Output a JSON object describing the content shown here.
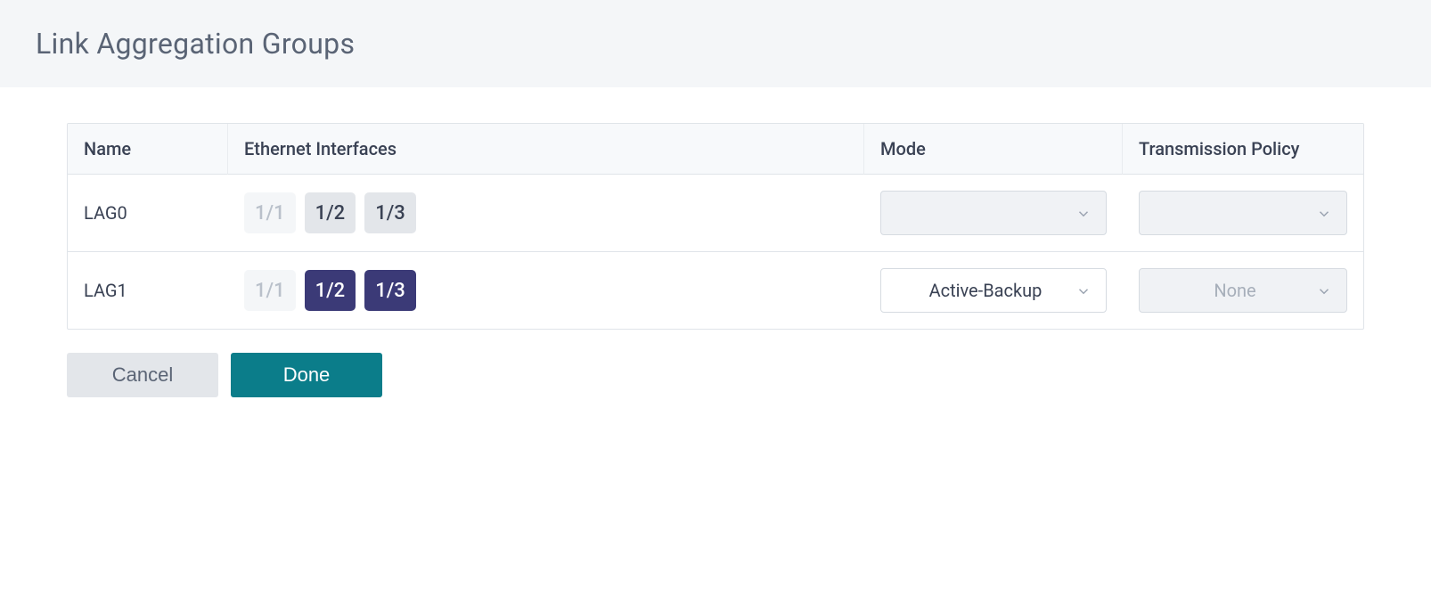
{
  "header": {
    "title": "Link Aggregation Groups"
  },
  "table": {
    "columns": {
      "name": "Name",
      "ethernet": "Ethernet Interfaces",
      "mode": "Mode",
      "policy": "Transmission Policy"
    },
    "rows": [
      {
        "name": "LAG0",
        "interfaces": [
          {
            "label": "1/1",
            "state": "disabled"
          },
          {
            "label": "1/2",
            "state": "available"
          },
          {
            "label": "1/3",
            "state": "available"
          }
        ],
        "mode": {
          "value": "",
          "disabled": true
        },
        "policy": {
          "value": "",
          "disabled": true
        }
      },
      {
        "name": "LAG1",
        "interfaces": [
          {
            "label": "1/1",
            "state": "disabled"
          },
          {
            "label": "1/2",
            "state": "selected"
          },
          {
            "label": "1/3",
            "state": "selected"
          }
        ],
        "mode": {
          "value": "Active-Backup",
          "disabled": false
        },
        "policy": {
          "value": "None",
          "disabled": true
        }
      }
    ]
  },
  "actions": {
    "cancel": "Cancel",
    "done": "Done"
  }
}
